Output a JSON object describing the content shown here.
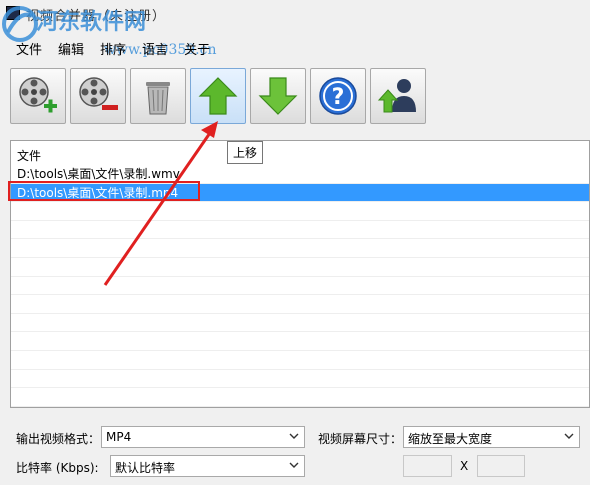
{
  "window": {
    "title": "视频合并器（未注册）"
  },
  "watermark": {
    "text": "河东软件网",
    "url": "www.pc0359.cn"
  },
  "menu": [
    "文件",
    "编辑",
    "排序",
    "语言",
    "关于"
  ],
  "toolbar": {
    "buttons": [
      "add-video",
      "remove-video",
      "clear-list",
      "move-up",
      "move-down",
      "help",
      "export"
    ],
    "tooltip": "上移"
  },
  "filelist": {
    "header": "文件",
    "rows": [
      "D:\\tools\\桌面\\文件\\录制.wmv",
      "D:\\tools\\桌面\\文件\\录制.mp4"
    ],
    "selected_index": 1
  },
  "settings": {
    "format_label": "输出视频格式：",
    "format_value": "MP4",
    "screen_label": "视频屏幕尺寸：",
    "screen_value": "缩放至最大宽度",
    "bitrate_label": "比特率 (Kbps):",
    "bitrate_value": "默认比特率",
    "x_sep": "X"
  },
  "colors": {
    "selection": "#3399ff",
    "annotation": "#e02020",
    "up_arrow": "#5cb82c"
  }
}
